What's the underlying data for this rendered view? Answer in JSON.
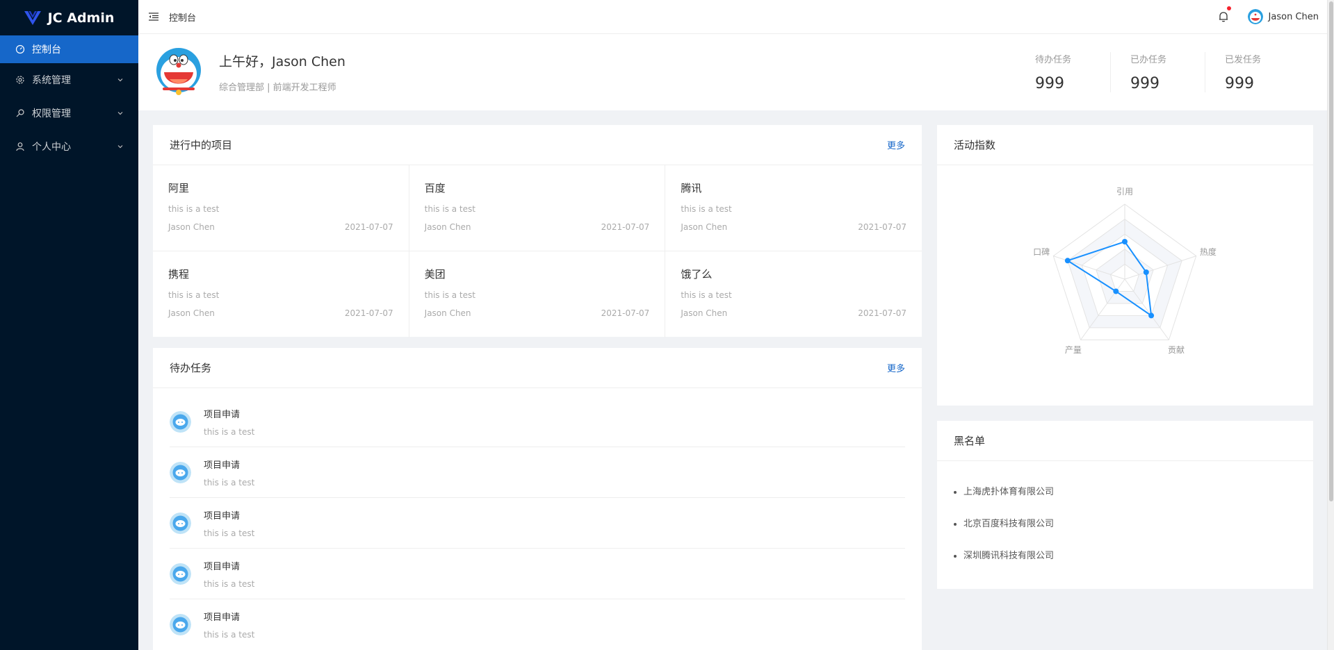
{
  "app": {
    "title": "JC Admin"
  },
  "sidebar": {
    "items": [
      {
        "label": "控制台",
        "icon": "dashboard-icon",
        "active": true
      },
      {
        "label": "系统管理",
        "icon": "gear-icon",
        "expandable": true
      },
      {
        "label": "权限管理",
        "icon": "key-icon",
        "expandable": true
      },
      {
        "label": "个人中心",
        "icon": "user-icon",
        "expandable": true
      }
    ]
  },
  "topbar": {
    "breadcrumb": "控制台",
    "user_name": "Jason Chen",
    "has_notification": true
  },
  "welcome": {
    "greeting": "上午好，Jason Chen",
    "subtitle": "综合管理部 | 前端开发工程师",
    "stats": [
      {
        "label": "待办任务",
        "value": "999"
      },
      {
        "label": "已办任务",
        "value": "999"
      },
      {
        "label": "已发任务",
        "value": "999"
      }
    ]
  },
  "projects": {
    "title": "进行中的项目",
    "more": "更多",
    "items": [
      {
        "name": "阿里",
        "desc": "this is a test",
        "owner": "Jason Chen",
        "date": "2021-07-07"
      },
      {
        "name": "百度",
        "desc": "this is a test",
        "owner": "Jason Chen",
        "date": "2021-07-07"
      },
      {
        "name": "腾讯",
        "desc": "this is a test",
        "owner": "Jason Chen",
        "date": "2021-07-07"
      },
      {
        "name": "携程",
        "desc": "this is a test",
        "owner": "Jason Chen",
        "date": "2021-07-07"
      },
      {
        "name": "美团",
        "desc": "this is a test",
        "owner": "Jason Chen",
        "date": "2021-07-07"
      },
      {
        "name": "饿了么",
        "desc": "this is a test",
        "owner": "Jason Chen",
        "date": "2021-07-07"
      }
    ]
  },
  "todos": {
    "title": "待办任务",
    "more": "更多",
    "items": [
      {
        "title": "项目申请",
        "desc": "this is a test"
      },
      {
        "title": "项目申请",
        "desc": "this is a test"
      },
      {
        "title": "项目申请",
        "desc": "this is a test"
      },
      {
        "title": "项目申请",
        "desc": "this is a test"
      },
      {
        "title": "项目申请",
        "desc": "this is a test"
      }
    ]
  },
  "activity": {
    "title": "活动指数",
    "chart_data": {
      "type": "radar",
      "indicators": [
        "引用",
        "热度",
        "贡献",
        "产量",
        "口碑"
      ],
      "max": 100,
      "series": [
        {
          "values": [
            50,
            30,
            60,
            20,
            80
          ]
        }
      ],
      "color": "#1890ff"
    }
  },
  "blacklist": {
    "title": "黑名单",
    "items": [
      "上海虎扑体育有限公司",
      "北京百度科技有限公司",
      "深圳腾讯科技有限公司"
    ]
  },
  "colors": {
    "sidebar_bg": "#001529",
    "accent": "#1667c9",
    "chart": "#1890ff"
  }
}
